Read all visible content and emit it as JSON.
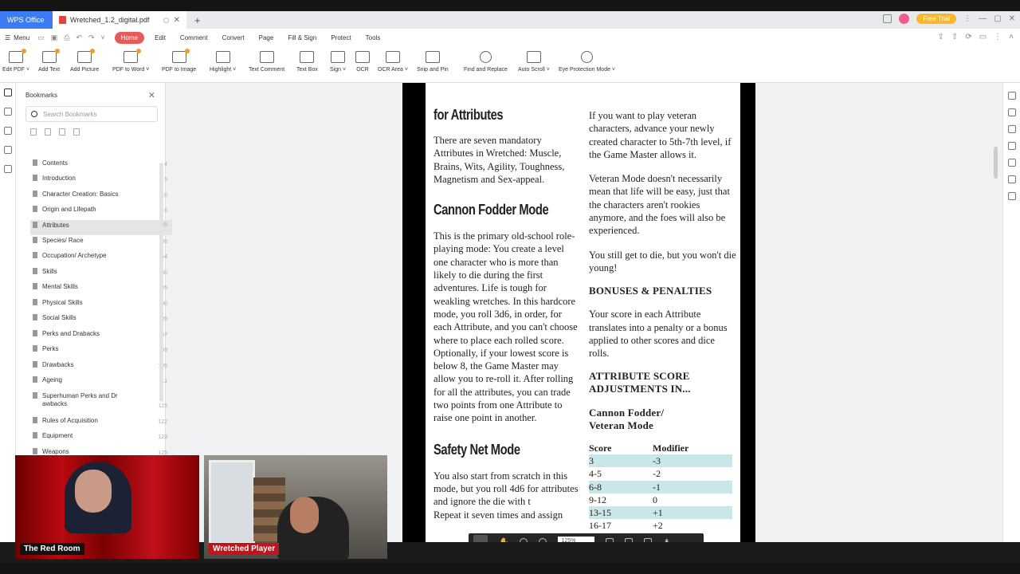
{
  "titlebar": {
    "app_tab": "WPS Office",
    "doc_tab": "Wretched_1.2_digital.pdf",
    "trial_badge": "Free Trial"
  },
  "menubar": {
    "menu_label": "Menu",
    "tabs": [
      "Home",
      "Edit",
      "Comment",
      "Convert",
      "Page",
      "Fill & Sign",
      "Protect",
      "Tools"
    ],
    "active_tab": "Home"
  },
  "ribbon": {
    "tools": [
      "Edit PDF ˅",
      "Add Text",
      "Add Picture",
      "PDF to Word ˅",
      "PDF to Image",
      "Highlight ˅",
      "Text Comment",
      "Text Box",
      "Sign ˅",
      "OCR",
      "OCR Area ˅",
      "Snip and Pin",
      "Find and Replace",
      "Auto Scroll ˅",
      "Eye Protection Mode ˅"
    ]
  },
  "bookmarks": {
    "title": "Bookmarks",
    "search_placeholder": "Search Bookmarks",
    "items": [
      {
        "label": "Contents",
        "page": "4"
      },
      {
        "label": "Introduction",
        "page": "5"
      },
      {
        "label": "Character Creation: Basics",
        "page": "10"
      },
      {
        "label": "Origin and Lifepath",
        "page": "16"
      },
      {
        "label": "Attributes",
        "page": "35"
      },
      {
        "label": "Species/ Race",
        "page": "38"
      },
      {
        "label": "Occupation/ Archetype",
        "page": "54"
      },
      {
        "label": "Skills",
        "page": "80"
      },
      {
        "label": "Mental Skills",
        "page": "85"
      },
      {
        "label": "Physical Skills",
        "page": "90"
      },
      {
        "label": "Social Skills",
        "page": "95"
      },
      {
        "label": "Perks and Drabacks",
        "page": "97"
      },
      {
        "label": "Perks",
        "page": "99"
      },
      {
        "label": "Drawbacks",
        "page": "105"
      },
      {
        "label": "Ageing",
        "page": "111"
      },
      {
        "label": "Superhuman Perks and Dr awbacks",
        "page": "115"
      },
      {
        "label": "Rules of Acquisition",
        "page": "122"
      },
      {
        "label": "Equipment",
        "page": "123"
      },
      {
        "label": "Weapons",
        "page": "125"
      }
    ],
    "selected": "Attributes"
  },
  "document": {
    "col1": {
      "heading1": "for Attributes",
      "para1": "There are seven mandatory Attributes in Wretched: Muscle, Brains, Wits, Agility, Toughness, Magnetism and Sex-appeal.",
      "heading2": "Cannon Fodder Mode",
      "para2": "This is the primary old-school role-playing mode: You create a level one character who is more than likely to die during the first adventures. Life is tough for weakling wretches. In this hardcore mode, you roll 3d6, in order, for each Attribute, and you can't choose where to place each rolled score. Optionally, if your lowest score is below 8, the Game Master may allow you to re-roll it. After rolling for all the attributes, you can trade two points from one Attribute to raise one point in another.",
      "heading3": "Safety Net Mode",
      "para3": "You also start from scratch in this mode, but you roll 4d6 for attributes and ignore the die with t",
      "para3b": "Repeat it seven times and assign"
    },
    "col2": {
      "para1": "If you want to play veteran characters, advance your newly created character to 5th-7th level, if the Game Master allows it.",
      "para2": "Veteran Mode doesn't necessarily mean that life will be easy, just that the characters aren't rookies anymore, and the foes will also be experienced.",
      "para3": "You still get to die, but you won't die young!",
      "heading1": "BONUSES & PENALTIES",
      "para4": "Your score in each Attribute translates into a penalty or a bonus applied to other scores and dice rolls.",
      "heading2": "ATTRIBUTE SCORE ADJUSTMENTS IN...",
      "table_title": "Cannon Fodder/ Veteran Mode",
      "table_headers": [
        "Score",
        "Modifier"
      ],
      "table_rows": [
        [
          "3",
          "-3"
        ],
        [
          "4-5",
          "-2"
        ],
        [
          "6-8",
          "-1"
        ],
        [
          "9-12",
          "0"
        ],
        [
          "13-15",
          "+1"
        ],
        [
          "16-17",
          "+2"
        ]
      ]
    }
  },
  "floating_toolbar": {
    "zoom": "125%"
  },
  "video": {
    "cam1_label": "The Red Room",
    "cam2_label": "Wretched Player"
  }
}
